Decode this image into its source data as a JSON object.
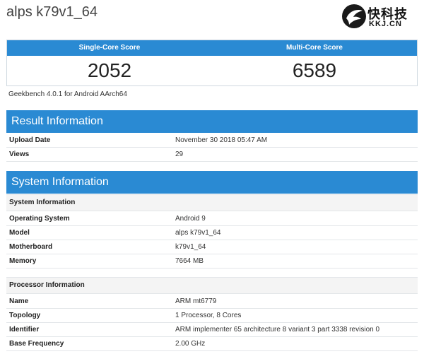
{
  "page": {
    "title": "alps k79v1_64"
  },
  "logo": {
    "cn_text": "快科技",
    "en_text": "KKJ.CN"
  },
  "scores": {
    "single_label": "Single-Core Score",
    "multi_label": "Multi-Core Score",
    "single_value": "2052",
    "multi_value": "6589"
  },
  "version": "Geekbench 4.0.1 for Android AArch64",
  "result": {
    "heading": "Result Information",
    "rows": [
      {
        "key": "Upload Date",
        "value": "November 30 2018 05:47 AM"
      },
      {
        "key": "Views",
        "value": "29"
      }
    ]
  },
  "system": {
    "heading": "System Information",
    "subheading": "System Information",
    "rows": [
      {
        "key": "Operating System",
        "value": "Android 9"
      },
      {
        "key": "Model",
        "value": "alps k79v1_64"
      },
      {
        "key": "Motherboard",
        "value": "k79v1_64"
      },
      {
        "key": "Memory",
        "value": "7664 MB"
      }
    ],
    "processor_subheading": "Processor Information",
    "processor_rows": [
      {
        "key": "Name",
        "value": "ARM mt6779"
      },
      {
        "key": "Topology",
        "value": "1 Processor, 8 Cores"
      },
      {
        "key": "Identifier",
        "value": "ARM implementer 65 architecture 8 variant 3 part 3338 revision 0"
      },
      {
        "key": "Base Frequency",
        "value": "2.00 GHz"
      }
    ]
  },
  "colors": {
    "accent": "#2a8ad3",
    "subhead_bg": "#f4f4f4"
  }
}
